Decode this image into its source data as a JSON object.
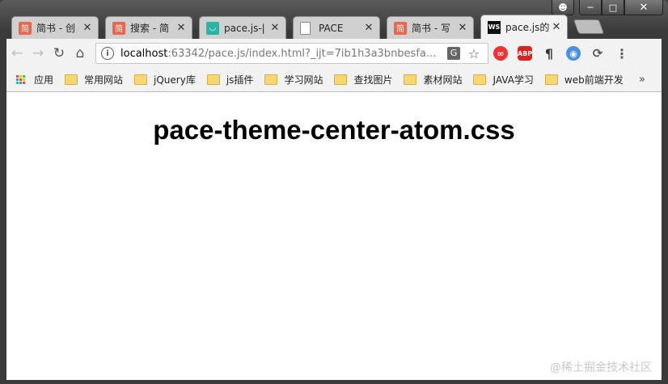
{
  "tabs": [
    {
      "title": "简书 - 创",
      "icon": "jianshu-icon",
      "icon_text": "简",
      "icon_color": "#e9664f",
      "active": false
    },
    {
      "title": "搜索 - 简",
      "icon": "jianshu-icon",
      "icon_text": "简",
      "icon_color": "#e9664f",
      "active": false
    },
    {
      "title": "pace.js-|",
      "icon": "pace-icon",
      "icon_text": "◡",
      "icon_color": "#2bb3a6",
      "active": false
    },
    {
      "title": "PACE",
      "icon": "page-icon",
      "icon_text": "",
      "icon_color": "#ffffff",
      "active": false
    },
    {
      "title": "简书 - 写",
      "icon": "jianshu-icon",
      "icon_text": "简",
      "icon_color": "#e9664f",
      "active": false
    },
    {
      "title": "pace.js的",
      "icon": "webstorm-icon",
      "icon_text": "WS",
      "icon_color": "#111111",
      "active": true
    }
  ],
  "address": {
    "host": "localhost",
    "rest": ":63342/pace.js/index.html?_ijt=7ib1h3a3bnbesfa..."
  },
  "bookmarks": {
    "apps_label": "应用",
    "items": [
      "常用网站",
      "jQuery库",
      "js插件",
      "学习网站",
      "查找图片",
      "素材网站",
      "JAVA学习",
      "web前端开发"
    ],
    "more": "»"
  },
  "page": {
    "heading": "pace-theme-center-atom.css"
  },
  "watermark": "@稀土掘金技术社区"
}
